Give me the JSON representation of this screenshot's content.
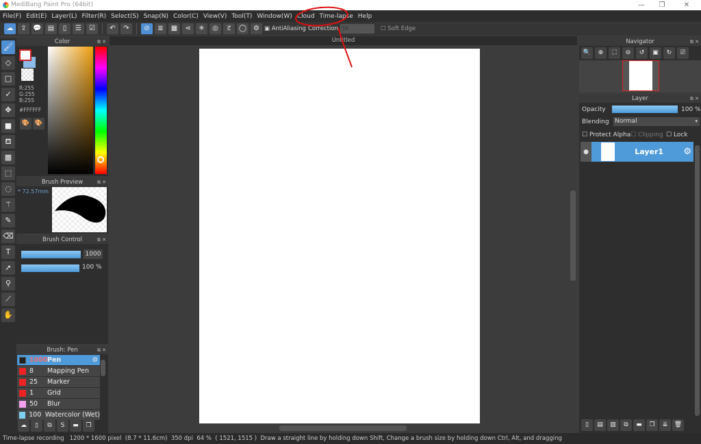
{
  "title": "MediBang Paint Pro (64bit)",
  "menu": [
    "File(F)",
    "Edit(E)",
    "Layer(L)",
    "Filter(R)",
    "Select(S)",
    "Snap(N)",
    "Color(C)",
    "View(V)",
    "Tool(T)",
    "Window(W)",
    "Cloud",
    "Time-lapse",
    "Help"
  ],
  "toolbar": {
    "antialiasing": "AntiAliasing",
    "correction_label": "Correction",
    "correction_value": "39",
    "soft_edge": "Soft Edge"
  },
  "color_panel": {
    "title": "Color",
    "r": "R:255",
    "g": "G:255",
    "b": "B:255",
    "hex": "#FFFFFF"
  },
  "brush_preview": {
    "title": "Brush Preview",
    "size": "* 72.57mm"
  },
  "brush_control": {
    "title": "Brush Control",
    "size_value": "1000",
    "opacity_value": "100 %",
    "size_fraction": 1.0,
    "opacity_fraction": 1.0
  },
  "brush_list": {
    "title": "Brush: Pen",
    "items": [
      {
        "size": "1000",
        "name": "Pen",
        "color": "#222222"
      },
      {
        "size": "8",
        "name": "Mapping Pen",
        "color": "#ee2222"
      },
      {
        "size": "25",
        "name": "Marker",
        "color": "#ee2222"
      },
      {
        "size": "1",
        "name": "Grid",
        "color": "#ee2222"
      },
      {
        "size": "50",
        "name": "Blur",
        "color": "#f4a0f0"
      },
      {
        "size": "100",
        "name": "Watercolor (Wet)",
        "color": "#7fd0f0"
      }
    ]
  },
  "canvas": {
    "title": "Untitled"
  },
  "navigator": {
    "title": "Navigator"
  },
  "layer_panel": {
    "title": "Layer",
    "opacity_label": "Opacity",
    "opacity_value": "100 %",
    "blending_label": "Blending",
    "blending_value": "Normal",
    "protect_alpha": "Protect Alpha",
    "clipping": "Clipping",
    "lock": "Lock",
    "layers": [
      {
        "name": "Layer1"
      }
    ]
  },
  "status": {
    "recording": "Time-lapse recording",
    "size": "1200 * 1600 pixel",
    "physical": "(8.7 * 11.6cm)",
    "dpi": "350 dpi",
    "zoom": "64 %",
    "coords": "( 1521, 1515 )",
    "hint": "Draw a straight line by holding down Shift, Change a brush size by holding down Ctrl, Alt, and dragging"
  }
}
